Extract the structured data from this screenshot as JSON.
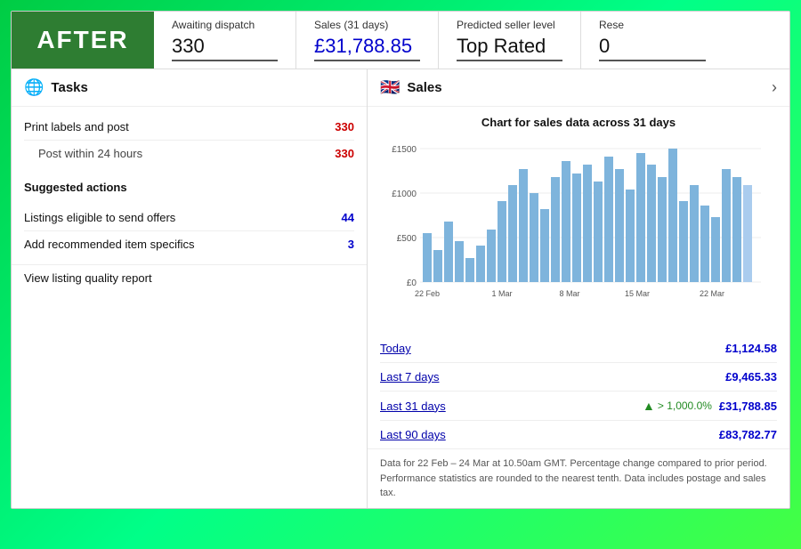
{
  "topbar": {
    "badge": "AFTER",
    "stats": [
      {
        "label": "Awaiting dispatch",
        "value": "330",
        "class": ""
      },
      {
        "label": "Sales (31 days)",
        "value": "£31,788.85",
        "class": "blue"
      },
      {
        "label": "Predicted seller level",
        "value": "Top Rated",
        "class": ""
      },
      {
        "label": "Rese",
        "value": "0",
        "class": ""
      }
    ]
  },
  "left_panel": {
    "header_icon": "🌐",
    "header_title": "Tasks",
    "tasks": [
      {
        "label": "Print labels and post",
        "count": "330",
        "count_class": "red",
        "indent": false
      },
      {
        "label": "Post within 24 hours",
        "count": "330",
        "count_class": "red",
        "indent": true
      }
    ],
    "suggested_header": "Suggested actions",
    "suggested_tasks": [
      {
        "label": "Listings eligible to send offers",
        "count": "44",
        "count_class": "blue"
      },
      {
        "label": "Add recommended item specifics",
        "count": "3",
        "count_class": "blue"
      }
    ],
    "view_report_label": "View listing quality report"
  },
  "right_panel": {
    "header_title": "Sales",
    "chart_title": "Chart for sales data across 31 days",
    "x_labels": [
      "22 Feb",
      "1 Mar",
      "8 Mar",
      "15 Mar",
      "22 Mar"
    ],
    "y_labels": [
      "£1500",
      "£1000",
      "£500",
      "£0"
    ],
    "bars": [
      120,
      80,
      150,
      100,
      60,
      90,
      130,
      200,
      240,
      280,
      220,
      180,
      260,
      300,
      270,
      290,
      250,
      310,
      280,
      230,
      320,
      290,
      260,
      330,
      200,
      240,
      190,
      160,
      280,
      260,
      240
    ],
    "sales_rows": [
      {
        "label": "Today",
        "value": "£1,124.58",
        "trend": ""
      },
      {
        "label": "Last 7 days",
        "value": "£9,465.33",
        "trend": ""
      },
      {
        "label": "Last 31 days",
        "value": "£31,788.85",
        "trend": "> 1,000.0%"
      },
      {
        "label": "Last 90 days",
        "value": "£83,782.77",
        "trend": ""
      }
    ],
    "footer_note": "Data for 22 Feb – 24 Mar at 10.50am GMT. Percentage change compared to prior period. Performance statistics are rounded to the nearest tenth. Data includes postage and sales tax."
  }
}
